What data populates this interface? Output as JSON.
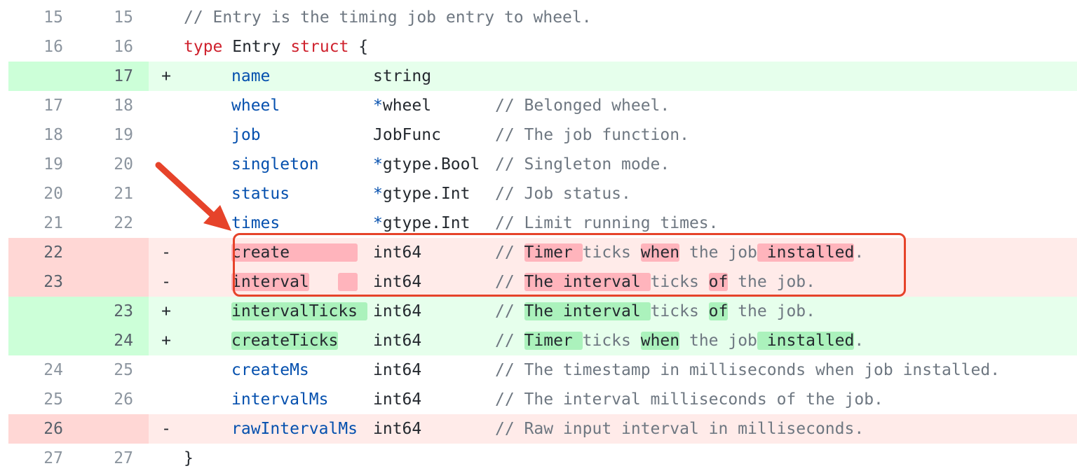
{
  "diff": {
    "rows": [
      {
        "type": "ctx",
        "old": "15",
        "new": "15",
        "sign": "",
        "segs": [
          {
            "t": "// Entry is the timing job entry to wheel.",
            "c": "cm"
          }
        ]
      },
      {
        "type": "ctx",
        "old": "16",
        "new": "16",
        "sign": "",
        "segs": [
          {
            "t": "type",
            "c": "kw"
          },
          {
            "t": " Entry ",
            "c": ""
          },
          {
            "t": "struct",
            "c": "kw"
          },
          {
            "t": " {",
            "c": ""
          }
        ]
      },
      {
        "type": "add",
        "old": "",
        "new": "17",
        "sign": "+",
        "indent": true,
        "cols": [
          [
            {
              "t": "name",
              "c": "fld"
            }
          ],
          [
            {
              "t": "string",
              "c": ""
            }
          ],
          []
        ]
      },
      {
        "type": "ctx",
        "old": "17",
        "new": "18",
        "sign": "",
        "indent": true,
        "cols": [
          [
            {
              "t": "wheel",
              "c": "fld"
            }
          ],
          [
            {
              "t": "*",
              "c": "op"
            },
            {
              "t": "wheel",
              "c": ""
            }
          ],
          [
            {
              "t": "// Belonged wheel.",
              "c": "cm"
            }
          ]
        ]
      },
      {
        "type": "ctx",
        "old": "18",
        "new": "19",
        "sign": "",
        "indent": true,
        "cols": [
          [
            {
              "t": "job",
              "c": "fld"
            }
          ],
          [
            {
              "t": "JobFunc",
              "c": ""
            }
          ],
          [
            {
              "t": "// The job function.",
              "c": "cm"
            }
          ]
        ]
      },
      {
        "type": "ctx",
        "old": "19",
        "new": "20",
        "sign": "",
        "indent": true,
        "cols": [
          [
            {
              "t": "singleton",
              "c": "fld"
            }
          ],
          [
            {
              "t": "*",
              "c": "op"
            },
            {
              "t": "gtype.Bool",
              "c": ""
            }
          ],
          [
            {
              "t": "// Singleton mode.",
              "c": "cm"
            }
          ]
        ]
      },
      {
        "type": "ctx",
        "old": "20",
        "new": "21",
        "sign": "",
        "indent": true,
        "cols": [
          [
            {
              "t": "status",
              "c": "fld"
            }
          ],
          [
            {
              "t": "*",
              "c": "op"
            },
            {
              "t": "gtype.Int",
              "c": ""
            }
          ],
          [
            {
              "t": "// Job status.",
              "c": "cm"
            }
          ]
        ]
      },
      {
        "type": "ctx",
        "old": "21",
        "new": "22",
        "sign": "",
        "indent": true,
        "cols": [
          [
            {
              "t": "times",
              "c": "fld"
            }
          ],
          [
            {
              "t": "*",
              "c": "op"
            },
            {
              "t": "gtype.Int",
              "c": ""
            }
          ],
          [
            {
              "t": "// Limit running times.",
              "c": "cm"
            }
          ]
        ]
      },
      {
        "type": "del",
        "old": "22",
        "new": "",
        "sign": "-",
        "indent": true,
        "cols": [
          [
            {
              "t": "create       ",
              "c": "hl-del"
            }
          ],
          [
            {
              "t": "int64",
              "c": ""
            }
          ],
          [
            {
              "t": "// ",
              "c": "cm"
            },
            {
              "t": "Timer ",
              "c": "hl-del"
            },
            {
              "t": "ticks ",
              "c": "cm"
            },
            {
              "t": "when",
              "c": "hl-del"
            },
            {
              "t": " the job",
              "c": "cm"
            },
            {
              "t": " installed",
              "c": "hl-del"
            },
            {
              "t": ".",
              "c": "cm"
            }
          ]
        ]
      },
      {
        "type": "del",
        "old": "23",
        "new": "",
        "sign": "-",
        "indent": true,
        "cols": [
          [
            {
              "t": "interval",
              "c": "hl-del"
            },
            {
              "t": "   ",
              "c": ""
            },
            {
              "t": "  ",
              "c": "hl-del"
            }
          ],
          [
            {
              "t": "int64",
              "c": ""
            }
          ],
          [
            {
              "t": "// ",
              "c": "cm"
            },
            {
              "t": "The interval ",
              "c": "hl-del"
            },
            {
              "t": "ticks ",
              "c": "cm"
            },
            {
              "t": "of",
              "c": "hl-del"
            },
            {
              "t": " the job.",
              "c": "cm"
            }
          ]
        ]
      },
      {
        "type": "add",
        "old": "",
        "new": "23",
        "sign": "+",
        "indent": true,
        "cols": [
          [
            {
              "t": "intervalTicks ",
              "c": "hl-add"
            }
          ],
          [
            {
              "t": "int64",
              "c": ""
            }
          ],
          [
            {
              "t": "// ",
              "c": "cm"
            },
            {
              "t": "The interval ",
              "c": "hl-add"
            },
            {
              "t": "ticks ",
              "c": "cm"
            },
            {
              "t": "of",
              "c": "hl-add"
            },
            {
              "t": " the job.",
              "c": "cm"
            }
          ]
        ]
      },
      {
        "type": "add",
        "old": "",
        "new": "24",
        "sign": "+",
        "indent": true,
        "cols": [
          [
            {
              "t": "createTicks",
              "c": "hl-add"
            }
          ],
          [
            {
              "t": "int64",
              "c": ""
            }
          ],
          [
            {
              "t": "// ",
              "c": "cm"
            },
            {
              "t": "Timer ",
              "c": "hl-add"
            },
            {
              "t": "ticks ",
              "c": "cm"
            },
            {
              "t": "when",
              "c": "hl-add"
            },
            {
              "t": " the job",
              "c": "cm"
            },
            {
              "t": " installed",
              "c": "hl-add"
            },
            {
              "t": ".",
              "c": "cm"
            }
          ]
        ]
      },
      {
        "type": "ctx",
        "old": "24",
        "new": "25",
        "sign": "",
        "indent": true,
        "cols": [
          [
            {
              "t": "createMs",
              "c": "fld"
            }
          ],
          [
            {
              "t": "int64",
              "c": ""
            }
          ],
          [
            {
              "t": "// The timestamp in milliseconds when job installed.",
              "c": "cm"
            }
          ]
        ]
      },
      {
        "type": "ctx",
        "old": "25",
        "new": "26",
        "sign": "",
        "indent": true,
        "cols": [
          [
            {
              "t": "intervalMs",
              "c": "fld"
            }
          ],
          [
            {
              "t": "int64",
              "c": ""
            }
          ],
          [
            {
              "t": "// The interval milliseconds of the job.",
              "c": "cm"
            }
          ]
        ]
      },
      {
        "type": "del",
        "old": "26",
        "new": "",
        "sign": "-",
        "indent": true,
        "cols": [
          [
            {
              "t": "rawIntervalMs",
              "c": "fld"
            }
          ],
          [
            {
              "t": "int64",
              "c": ""
            }
          ],
          [
            {
              "t": "// Raw input interval in milliseconds.",
              "c": "cm"
            }
          ]
        ]
      },
      {
        "type": "ctx",
        "old": "27",
        "new": "27",
        "sign": "",
        "segs": [
          {
            "t": "}",
            "c": ""
          }
        ]
      }
    ]
  },
  "annotation": {
    "color": "#e6432a"
  }
}
